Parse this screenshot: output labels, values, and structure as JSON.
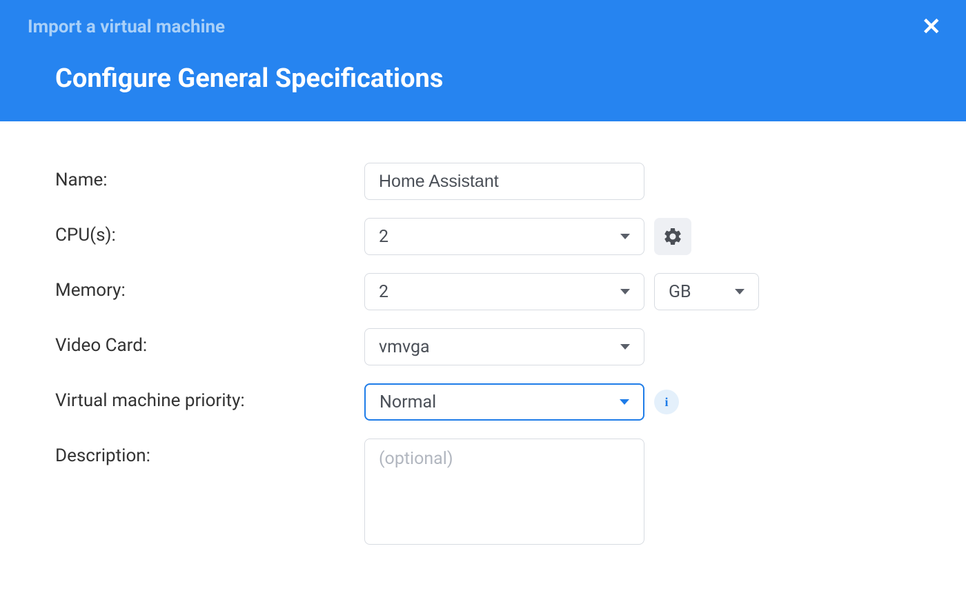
{
  "header": {
    "breadcrumb": "Import a virtual machine",
    "title": "Configure General Specifications"
  },
  "form": {
    "name": {
      "label": "Name:",
      "value": "Home Assistant"
    },
    "cpus": {
      "label": "CPU(s):",
      "value": "2"
    },
    "memory": {
      "label": "Memory:",
      "value": "2",
      "unit": "GB"
    },
    "video_card": {
      "label": "Video Card:",
      "value": "vmvga"
    },
    "priority": {
      "label": "Virtual machine priority:",
      "value": "Normal"
    },
    "description": {
      "label": "Description:",
      "placeholder": "(optional)"
    }
  }
}
